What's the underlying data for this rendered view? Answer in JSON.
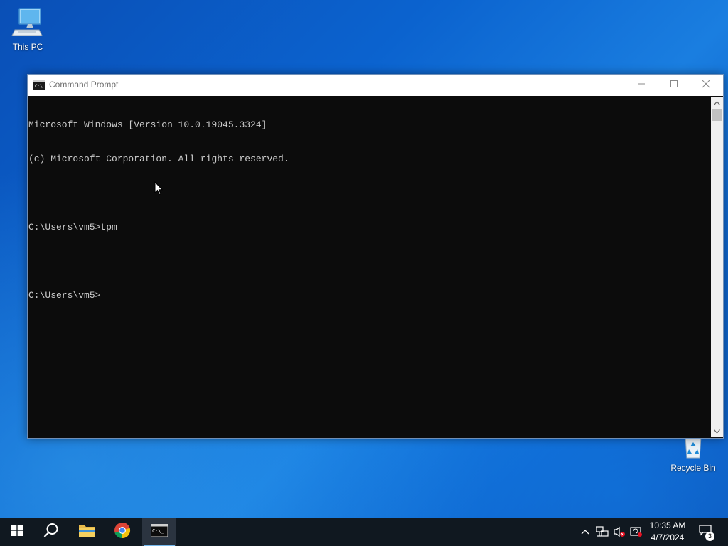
{
  "desktop": {
    "icons": [
      {
        "label": "This PC",
        "icon": "this-pc-icon"
      },
      {
        "label": "Recycle Bin",
        "icon": "recycle-bin-icon"
      }
    ],
    "colors": {
      "accent": "#0b63cf"
    }
  },
  "window": {
    "title": "Command Prompt",
    "icon": "cmd-icon",
    "controls": {
      "minimize": "minimize-icon",
      "maximize": "maximize-icon",
      "close": "close-icon"
    },
    "console_lines": [
      "Microsoft Windows [Version 10.0.19045.3324]",
      "(c) Microsoft Corporation. All rights reserved.",
      "",
      "C:\\Users\\vm5>tpm",
      "",
      "C:\\Users\\vm5>"
    ]
  },
  "taskbar": {
    "items": [
      {
        "name": "start",
        "icon": "windows-logo-icon"
      },
      {
        "name": "search",
        "icon": "search-icon"
      },
      {
        "name": "file-explorer",
        "icon": "folder-icon"
      },
      {
        "name": "chrome",
        "icon": "chrome-icon"
      },
      {
        "name": "command-prompt",
        "icon": "cmd-icon",
        "active": true
      }
    ],
    "tray": {
      "icons": [
        "chevron-up-icon",
        "network-icon",
        "volume-muted-icon",
        "security-icon"
      ],
      "time": "10:35 AM",
      "date": "4/7/2024",
      "notification_count": "3"
    }
  }
}
